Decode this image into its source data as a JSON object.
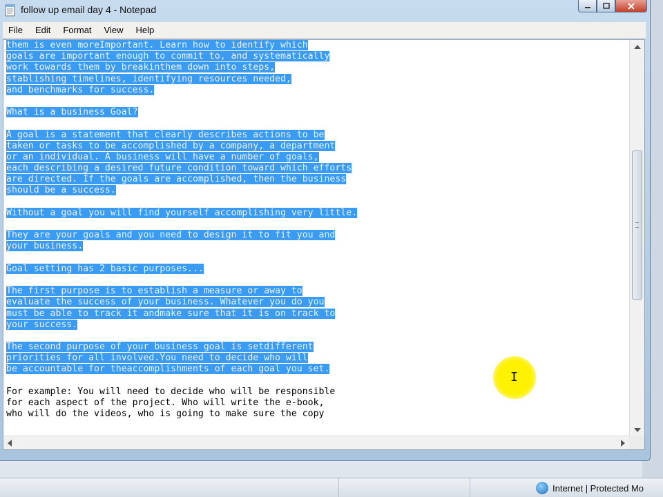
{
  "window": {
    "title": "follow up email day 4 - Notepad"
  },
  "menu": [
    "File",
    "Edit",
    "Format",
    "View",
    "Help"
  ],
  "document": {
    "lines": [
      {
        "text": "them is even moreImportant. Learn how to identify which",
        "selected": true
      },
      {
        "text": "goals are important enough to commit to, and systematically",
        "selected": true
      },
      {
        "text": "work towards them by breakinthem down into steps,",
        "selected": true
      },
      {
        "text": "stablishing timelines, identifying resources needed,",
        "selected": true
      },
      {
        "text": "and benchmarks for success.",
        "selected": true
      },
      {
        "text": "",
        "selected": false
      },
      {
        "text": "What is a business Goal?",
        "selected": true
      },
      {
        "text": "",
        "selected": false
      },
      {
        "text": "A goal is a statement that clearly describes actions to be",
        "selected": true
      },
      {
        "text": "taken or tasks to be accomplished by a company, a department",
        "selected": true
      },
      {
        "text": "or an individual. A business will have a number of goals,",
        "selected": true
      },
      {
        "text": "each describing a desired future condition toward which efforts",
        "selected": true
      },
      {
        "text": "are directed. If the goals are accomplished, then the business",
        "selected": true
      },
      {
        "text": "should be a success.",
        "selected": true
      },
      {
        "text": "",
        "selected": false
      },
      {
        "text": "Without a goal you will find yourself accomplishing very little.",
        "selected": true
      },
      {
        "text": "",
        "selected": false
      },
      {
        "text": "They are your goals and you need to design it to fit you and",
        "selected": true
      },
      {
        "text": "your business.",
        "selected": true
      },
      {
        "text": "",
        "selected": false
      },
      {
        "text": "Goal setting has 2 basic purposes...",
        "selected": true
      },
      {
        "text": "",
        "selected": false
      },
      {
        "text": "The first purpose is to establish a measure or away to",
        "selected": true
      },
      {
        "text": "evaluate the success of your business. Whatever you do you",
        "selected": true
      },
      {
        "text": "must be able to track it andmake sure that it is on track to",
        "selected": true
      },
      {
        "text": "your success.",
        "selected": true
      },
      {
        "text": "",
        "selected": false
      },
      {
        "text": "The second purpose of your business goal is setdifferent",
        "selected": true
      },
      {
        "text": "priorities for all involved.You need to decide who will",
        "selected": true
      },
      {
        "text": "be accountable for theaccomplishments of each goal you set.",
        "selected": true
      },
      {
        "text": "",
        "selected": false
      },
      {
        "text": "For example: You will need to decide who will be responsible",
        "selected": false
      },
      {
        "text": "for each aspect of the project. Who will write the e-book,",
        "selected": false
      },
      {
        "text": "who will do the videos, who is going to make sure the copy",
        "selected": false
      }
    ]
  },
  "status": {
    "zone_text": "Internet | Protected Mo"
  },
  "colors": {
    "selection": "#3a9bf0",
    "cursor_highlight": "#fff200"
  },
  "icons": [
    "notepad-icon",
    "minimize-icon",
    "maximize-icon",
    "close-icon",
    "globe-icon",
    "text-cursor-icon"
  ]
}
